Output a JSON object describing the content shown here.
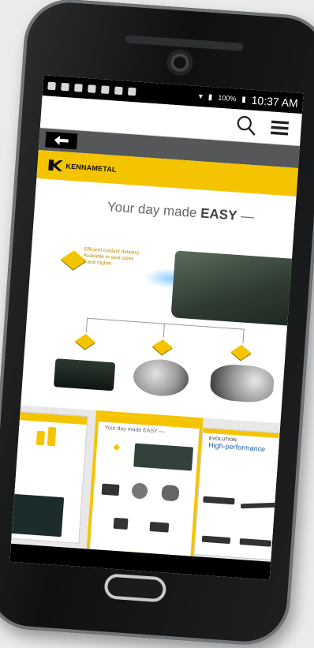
{
  "status_bar": {
    "battery": "100%",
    "time": "10:37 AM"
  },
  "app_bar": {
    "search_icon": "search-icon",
    "menu_icon": "hamburger-menu-icon",
    "back_icon": "back-arrow-icon"
  },
  "brand": {
    "name": "KENNAMETAL",
    "accent_color": "#f5c400"
  },
  "hero": {
    "headline_prefix": "Your day made ",
    "headline_bold": "EASY",
    "headline_suffix": " —",
    "feature_text_1": "Efficient coolant delivery.",
    "feature_text_2": "Available in seat sizes",
    "feature_text_3": "2 and higher."
  },
  "thumbnails": [
    {
      "label": "",
      "selected": false
    },
    {
      "label": "Your day made EASY —",
      "selected": true
    },
    {
      "label": "EVOLUTION",
      "subtitle": "High-performance",
      "selected": false
    }
  ]
}
